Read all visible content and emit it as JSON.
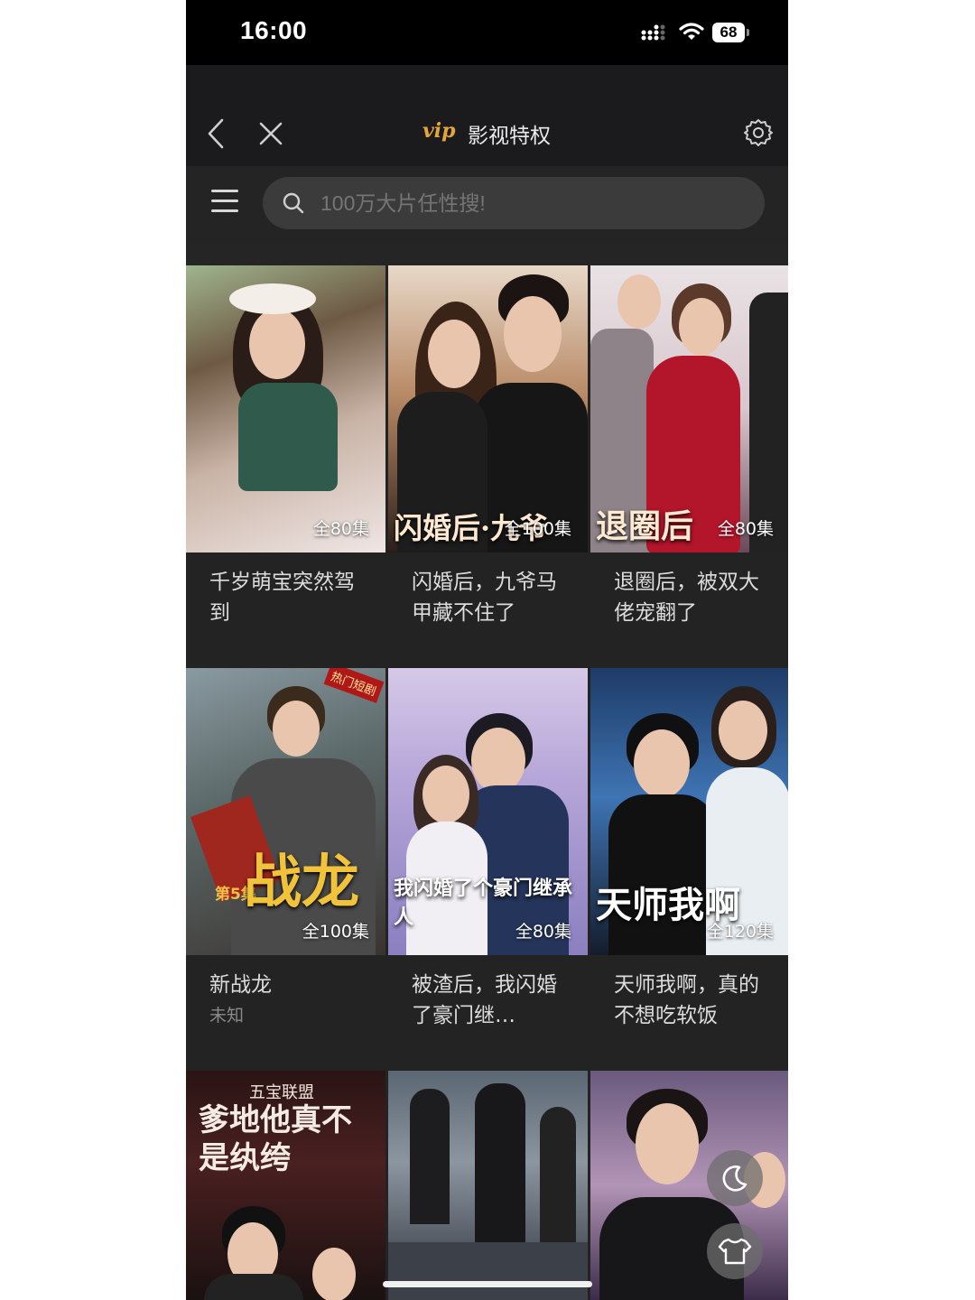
{
  "status_bar": {
    "time": "16:00",
    "battery": "68"
  },
  "nav": {
    "vip_badge": "vip",
    "title": "影视特权"
  },
  "search": {
    "placeholder": "100万大片任性搜!"
  },
  "grid": {
    "items": [
      {
        "title": "千岁萌宝突然驾到",
        "episodes": "全80集",
        "poster_text": ""
      },
      {
        "title": "闪婚后，九爷马甲藏不住了",
        "episodes": "全100集",
        "poster_text": "闪婚后·九爷"
      },
      {
        "title": "退圈后，被双大佬宠翻了",
        "episodes": "全80集",
        "poster_text": "退圈后"
      },
      {
        "title": "新战龙",
        "subtitle": "未知",
        "episodes": "全100集",
        "poster_text": "战龙",
        "tag": "热门短剧",
        "badge": "第5集"
      },
      {
        "title": "被渣后，我闪婚了豪门继…",
        "episodes": "全80集",
        "poster_text": "我闪婚了个豪门继承人"
      },
      {
        "title": "天师我啊，真的不想吃软饭",
        "episodes": "全120集",
        "poster_text": "天师我啊"
      },
      {
        "title": "",
        "poster_text": "爹地他真不是纨绔",
        "poster_subtext": "五宝联盟"
      },
      {
        "title": "",
        "poster_text": ""
      },
      {
        "title": "",
        "poster_text": ""
      }
    ]
  },
  "floating": {
    "moon": "moon-icon",
    "shirt": "shirt-icon"
  }
}
